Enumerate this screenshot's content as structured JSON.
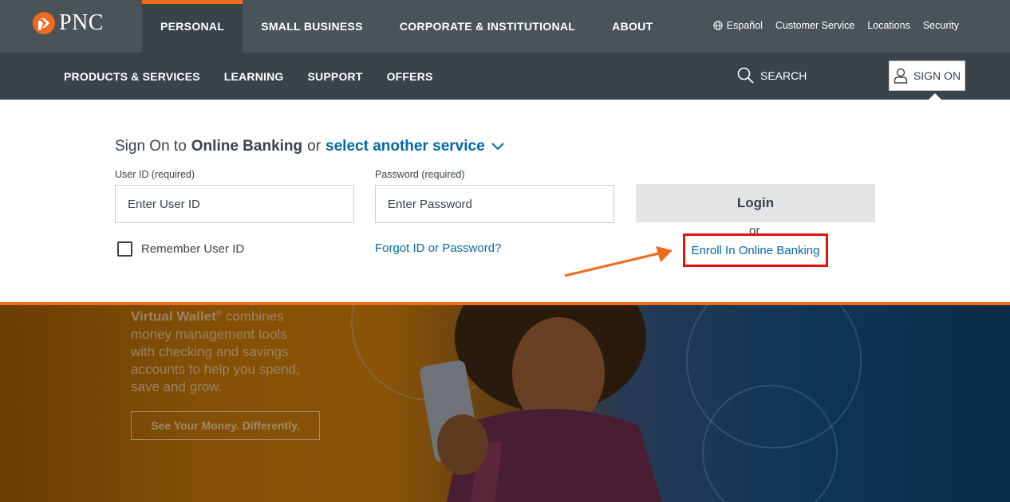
{
  "brand": {
    "name": "PNC",
    "accent": "#ef6a1b",
    "link_color": "#0069aa",
    "highlight": "#e3120b"
  },
  "main_nav": [
    "PERSONAL",
    "SMALL BUSINESS",
    "CORPORATE & INSTITUTIONAL",
    "ABOUT"
  ],
  "util_nav": {
    "espanol": "Español",
    "customer_service": "Customer Service",
    "locations": "Locations",
    "security": "Security"
  },
  "sub_nav": [
    "PRODUCTS & SERVICES",
    "LEARNING",
    "SUPPORT",
    "OFFERS"
  ],
  "search_label": "SEARCH",
  "signon_label": "SIGN ON",
  "signin": {
    "heading_prefix": "Sign On to",
    "heading_service": "Online Banking",
    "heading_or": "or",
    "heading_link": "select another service",
    "user_label": "User ID (required)",
    "user_placeholder": "Enter User ID",
    "password_label": "Password (required)",
    "password_placeholder": "Enter Password",
    "login_label": "Login",
    "or_text": "or",
    "enroll_label": "Enroll In Online Banking",
    "remember_label": "Remember User ID",
    "forgot_label": "Forgot ID or Password?"
  },
  "hero": {
    "brand_word": "Virtual Wallet",
    "reg": "®",
    "text_rest": " combines money management tools with checking and savings accounts to help you spend, save and grow.",
    "button_label": "See Your Money. Differently."
  }
}
